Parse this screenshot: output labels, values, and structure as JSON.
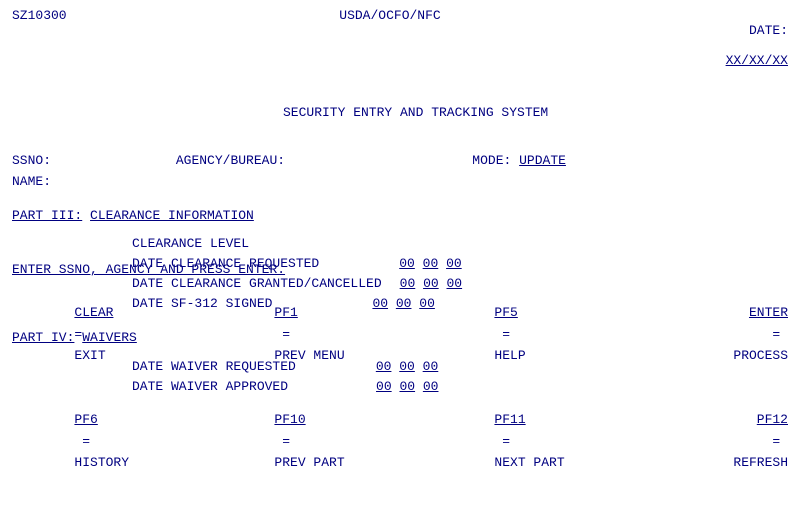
{
  "header": {
    "system_id": "SZ10300",
    "title_center": "USDA/OCFO/NFC",
    "subtitle": "SECURITY ENTRY AND TRACKING SYSTEM",
    "date_label": "DATE:",
    "date_value": "XX/XX/XX"
  },
  "form": {
    "ssno_label": "SSNO:",
    "agency_label": "AGENCY/BUREAU:",
    "mode_label": "MODE:",
    "mode_value": "UPDATE",
    "name_label": "NAME:"
  },
  "part3": {
    "label": "PART III:",
    "title": "CLEARANCE INFORMATION",
    "clearance_level_label": "CLEARANCE LEVEL",
    "date_requested_label": "DATE CLEARANCE REQUESTED",
    "date_requested_mm": "00",
    "date_requested_dd": "00",
    "date_requested_yy": "00",
    "date_granted_label": "DATE CLEARANCE GRANTED/CANCELLED",
    "date_granted_mm": "00",
    "date_granted_dd": "00",
    "date_granted_yy": "00",
    "date_sf312_label": "DATE SF-312 SIGNED",
    "date_sf312_mm": "00",
    "date_sf312_dd": "00",
    "date_sf312_yy": "00"
  },
  "part4": {
    "label": "PART IV:",
    "title": "WAIVERS",
    "date_waiver_req_label": "DATE WAIVER REQUESTED",
    "date_waiver_req_mm": "00",
    "date_waiver_req_dd": "00",
    "date_waiver_req_yy": "00",
    "date_waiver_app_label": "DATE WAIVER APPROVED",
    "date_waiver_app_mm": "00",
    "date_waiver_app_dd": "00",
    "date_waiver_app_yy": "00"
  },
  "footer": {
    "instruction": "ENTER SSNO, AGENCY AND PRESS ENTER.",
    "clear_label": "CLEAR",
    "clear_equals": "=",
    "clear_value": "EXIT",
    "pf1_label": "PF1",
    "pf1_equals": "=",
    "pf1_value": "PREV MENU",
    "pf5_label": "PF5",
    "pf5_equals": "=",
    "pf5_value": "HELP",
    "enter_label": "ENTER",
    "enter_equals": "=",
    "enter_value": "PROCESS",
    "pf6_label": "PF6",
    "pf6_equals": "=",
    "pf6_value": "HISTORY",
    "pf10_label": "PF10",
    "pf10_equals": "=",
    "pf10_value": "PREV PART",
    "pf11_label": "PF11",
    "pf11_equals": "=",
    "pf11_value": "NEXT PART",
    "pf12_label": "PF12",
    "pf12_equals": "=",
    "pf12_value": "REFRESH"
  }
}
